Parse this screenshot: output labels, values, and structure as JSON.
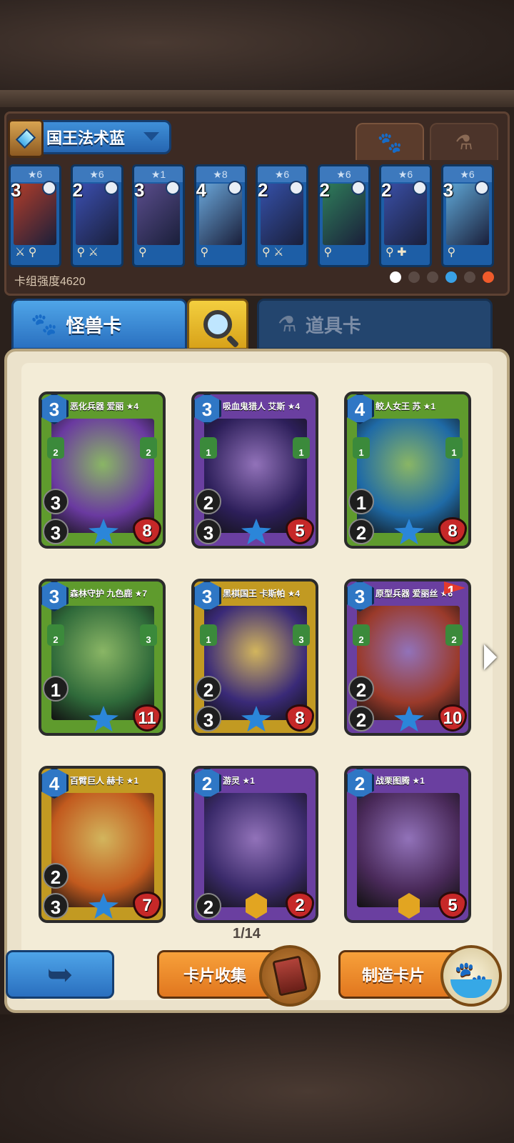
{
  "deck": {
    "name": "国王法术蓝",
    "strength_label": "卡组强度4620",
    "type_tabs": {
      "monster_icon": "paw-icon",
      "item_icon": "potion-icon"
    },
    "cards": [
      {
        "stars": "★6",
        "cost": "3",
        "element": "ice-icon",
        "tools": "sword,key",
        "color": "#b13d2a"
      },
      {
        "stars": "★6",
        "cost": "2",
        "element": "ice-icon",
        "tools": "key,sword",
        "color": "#3b4fb0"
      },
      {
        "stars": "★1",
        "cost": "3",
        "element": "ice-icon",
        "tools": "key",
        "color": "#5a4d8c"
      },
      {
        "stars": "★8",
        "cost": "4",
        "element": "ice-icon",
        "tools": "key",
        "color": "#6aa6d9"
      },
      {
        "stars": "★6",
        "cost": "2",
        "element": "ice-icon",
        "tools": "key,sword",
        "color": "#3550a8"
      },
      {
        "stars": "★6",
        "cost": "2",
        "element": "rainbow-icon",
        "tools": "key",
        "color": "#2f7d5a"
      },
      {
        "stars": "★6",
        "cost": "2",
        "element": "gold-icon",
        "tools": "key,heal",
        "color": "#3a4fa6"
      },
      {
        "stars": "★6",
        "cost": "3",
        "element": "rainbow-icon",
        "tools": "key",
        "color": "#5fa7d6"
      }
    ],
    "filters": [
      "#ffffff",
      "#5a4a44",
      "#5a4a44",
      "#39a1e6",
      "#5a4a44",
      "#f05b2b"
    ]
  },
  "tabs": {
    "monster_label": "怪兽卡",
    "item_label": "道具卡"
  },
  "collection": {
    "page": "1/14",
    "cards": [
      {
        "title": "恶化兵器 爱丽 ★4",
        "cost": "3",
        "speed": "3",
        "attack": "3",
        "hp": "8",
        "left_stat": "2",
        "right_stat": "2",
        "band": "#5f9b2d",
        "art": "#6a3aa0"
      },
      {
        "title": "吸血鬼猎人 艾斯 ★4",
        "cost": "3",
        "speed": "2",
        "attack": "3",
        "hp": "5",
        "left_stat": "1",
        "right_stat": "1",
        "band": "#6a3fa0",
        "art": "#2d1f5a"
      },
      {
        "title": "鲛人女王 苏 ★1",
        "cost": "4",
        "speed": "1",
        "attack": "2",
        "hp": "8",
        "left_stat": "1",
        "right_stat": "1",
        "band": "#5f9b2d",
        "art": "#1f6aa6"
      },
      {
        "title": "森林守护 九色鹿 ★7",
        "cost": "3",
        "speed": "1",
        "attack": "",
        "hp": "11",
        "left_stat": "2",
        "right_stat": "3",
        "band": "#5f9b2d",
        "art": "#2f6a3a"
      },
      {
        "title": "黑棋国王 卡斯帕 ★4",
        "cost": "3",
        "speed": "2",
        "attack": "3",
        "hp": "8",
        "left_stat": "1",
        "right_stat": "3",
        "band": "#c29a22",
        "art": "#3a2a78"
      },
      {
        "title": "原型兵器 爱丽丝 ★6",
        "cost": "3",
        "speed": "2",
        "attack": "2",
        "hp": "10",
        "left_stat": "2",
        "right_stat": "2",
        "band": "#6a3fa0",
        "art": "#9a3a2a",
        "flag": "1"
      },
      {
        "title": "百臂巨人 赫卡 ★1",
        "cost": "4",
        "speed": "2",
        "attack": "3",
        "hp": "7",
        "left_stat": "",
        "right_stat": "",
        "band": "#c29a22",
        "art": "#c25a1e"
      },
      {
        "title": "游灵 ★1",
        "cost": "2",
        "speed": "",
        "attack": "2",
        "hp": "2",
        "left_stat": "",
        "right_stat": "",
        "band": "#6a3fa0",
        "art": "#3a2a6a"
      },
      {
        "title": "战栗图腾 ★1",
        "cost": "2",
        "speed": "",
        "attack": "",
        "hp": "5",
        "left_stat": "",
        "right_stat": "",
        "band": "#6a3fa0",
        "art": "#4a2a5a"
      }
    ]
  },
  "bottom": {
    "collect_label": "卡片收集",
    "craft_label": "制造卡片"
  }
}
